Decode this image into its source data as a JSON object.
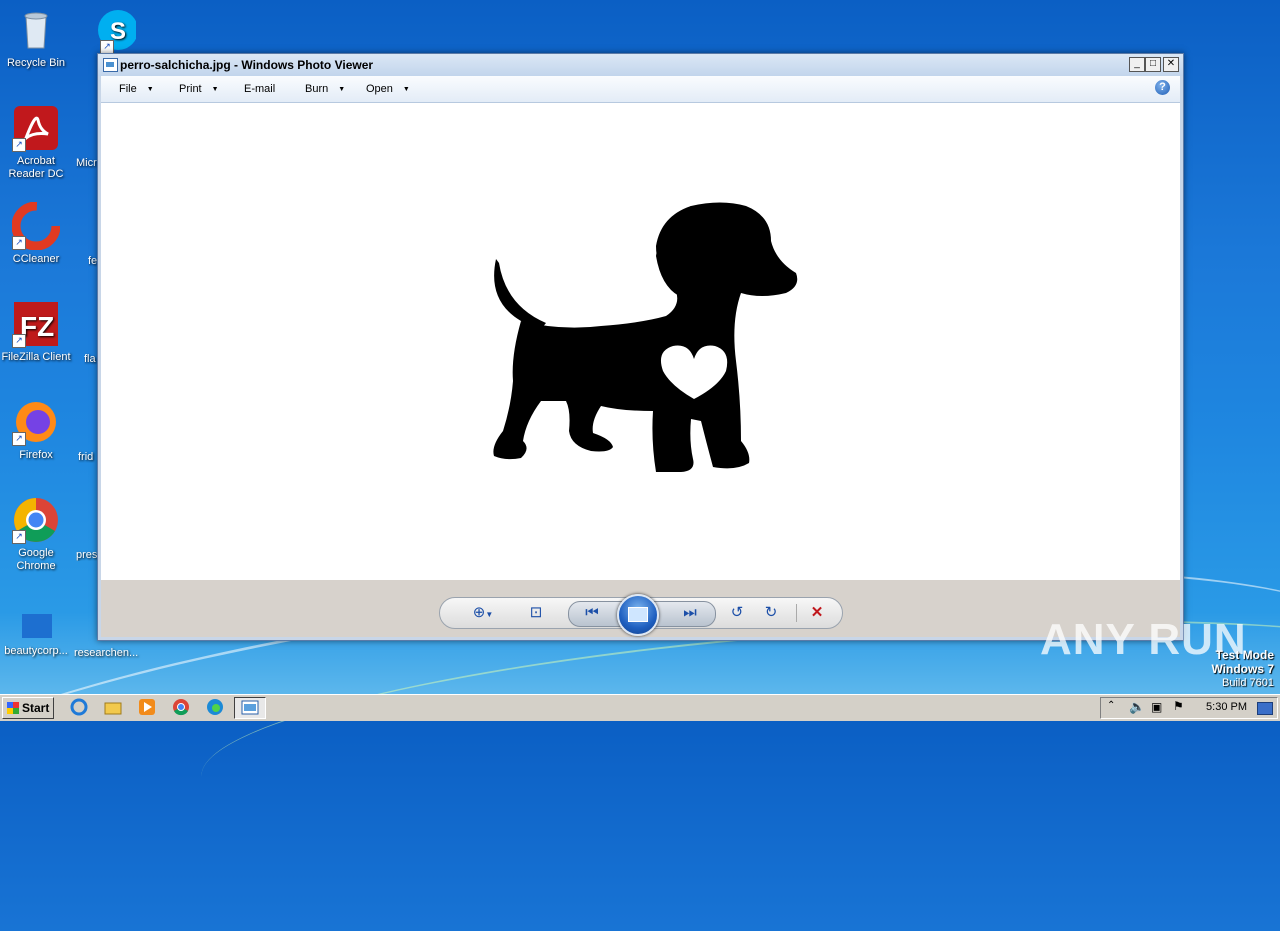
{
  "desktop": {
    "icons": [
      {
        "label": "Recycle Bin"
      },
      {
        "label": "Acrobat Reader DC"
      },
      {
        "label": "CCleaner"
      },
      {
        "label": "FileZilla Client"
      },
      {
        "label": "Firefox"
      },
      {
        "label": "Google Chrome"
      },
      {
        "label": "beautycorp..."
      }
    ],
    "icons_col2": [
      {
        "label": ""
      },
      {
        "label": "Micr"
      },
      {
        "label": "fe"
      },
      {
        "label": "fla"
      },
      {
        "label": "frid"
      },
      {
        "label": "pres"
      },
      {
        "label": "researchen..."
      }
    ]
  },
  "window": {
    "title": "perro-salchicha.jpg - Windows Photo Viewer",
    "menu": [
      "File",
      "Print",
      "E-mail",
      "Burn",
      "Open"
    ],
    "help": "?"
  },
  "taskbar": {
    "start": "Start",
    "clock": "5:30 PM"
  },
  "overlay": {
    "watermark": "ANY RUN",
    "test_mode": "Test Mode",
    "os": "Windows 7",
    "build": "Build 7601"
  }
}
